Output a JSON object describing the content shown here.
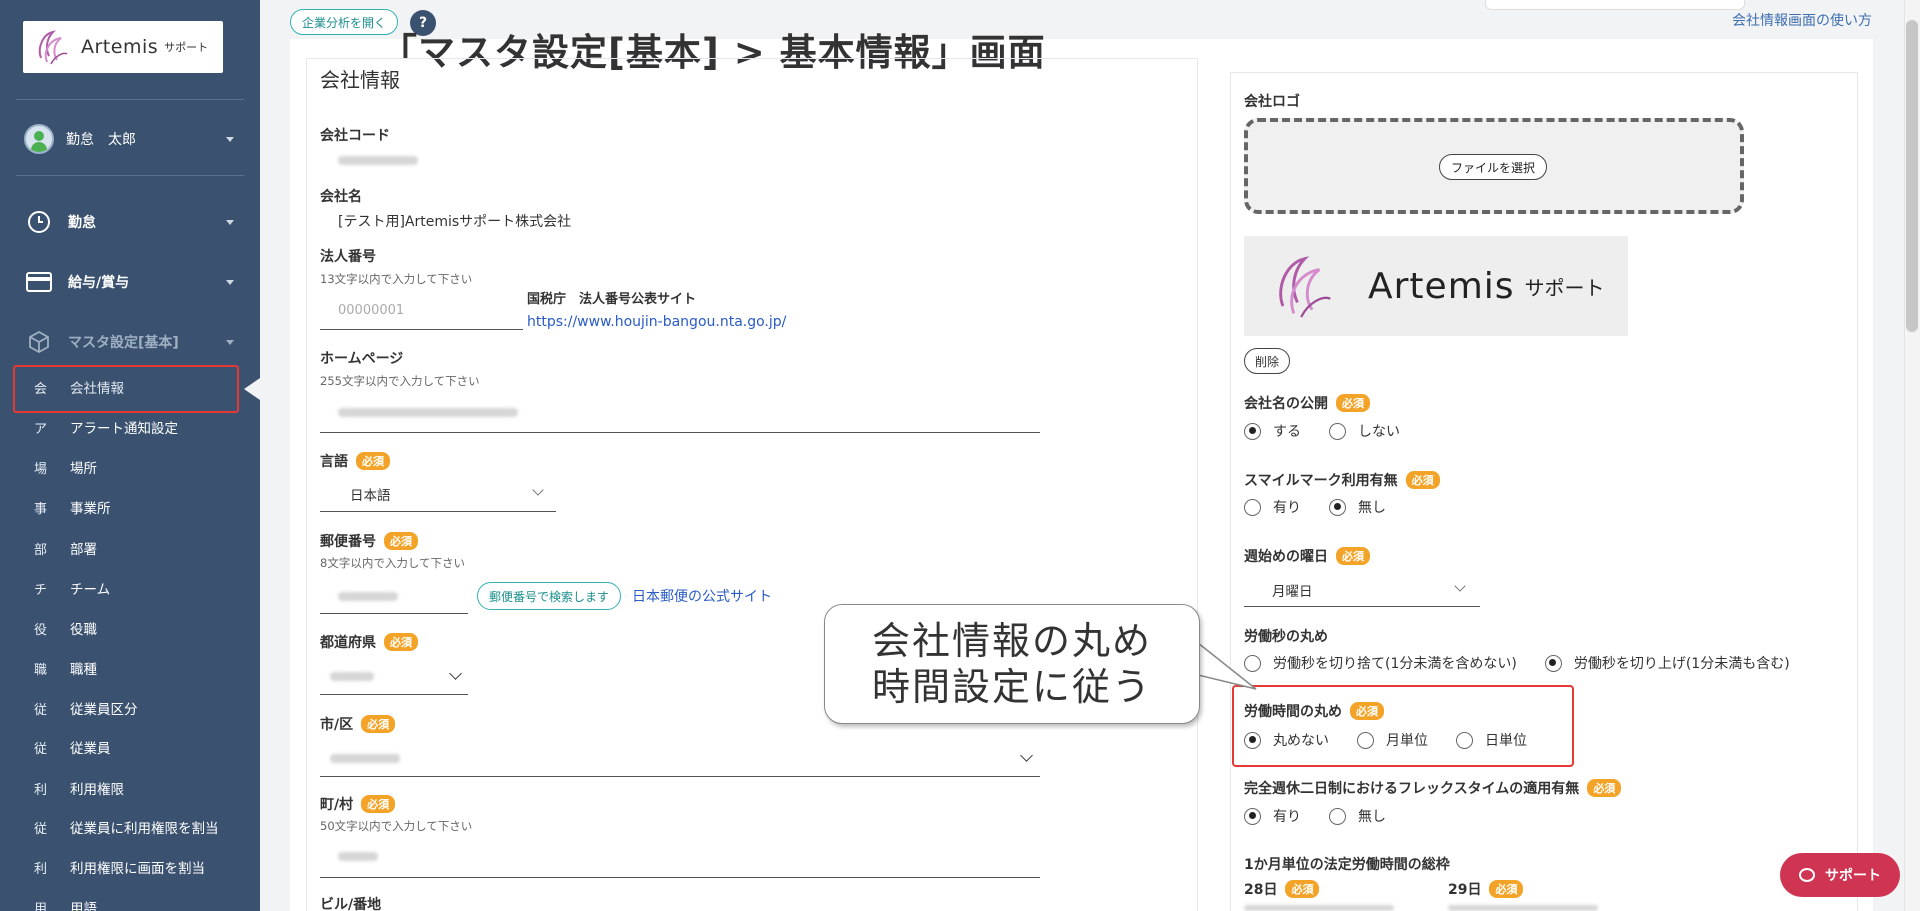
{
  "sidebar": {
    "logo": {
      "name": "Artemis",
      "sub": "サポート"
    },
    "user": {
      "name": "勤怠　太郎"
    },
    "nav": [
      {
        "label": "勤怠",
        "icon": "clock-icon"
      },
      {
        "label": "給与/賞与",
        "icon": "credit-card-icon"
      },
      {
        "label": "マスタ設定[基本]",
        "icon": "cube-icon"
      }
    ],
    "items": [
      {
        "ch": "会",
        "label": "会社情報"
      },
      {
        "ch": "ア",
        "label": "アラート通知設定"
      },
      {
        "ch": "場",
        "label": "場所"
      },
      {
        "ch": "事",
        "label": "事業所"
      },
      {
        "ch": "部",
        "label": "部署"
      },
      {
        "ch": "チ",
        "label": "チーム"
      },
      {
        "ch": "役",
        "label": "役職"
      },
      {
        "ch": "職",
        "label": "職種"
      },
      {
        "ch": "従",
        "label": "従業員区分"
      },
      {
        "ch": "従",
        "label": "従業員"
      },
      {
        "ch": "利",
        "label": "利用権限"
      },
      {
        "ch": "従",
        "label": "従業員に利用権限を割当"
      },
      {
        "ch": "利",
        "label": "利用権限に画面を割当"
      },
      {
        "ch": "用",
        "label": "用語"
      }
    ]
  },
  "header": {
    "analysis_button": "企業分析を開く",
    "help_icon": "?",
    "page_heading": "「マスタ設定[基本] > 基本情報」画面",
    "help_link": "会社情報画面の使い方"
  },
  "left": {
    "section_title": "会社情報",
    "company_code": {
      "label": "会社コード"
    },
    "company_name": {
      "label": "会社名",
      "value": "[テスト用]Artemisサポート株式会社"
    },
    "corp_number": {
      "label": "法人番号",
      "hint": "13文字以内で入力して下さい",
      "placeholder": "00000001",
      "site_label": "国税庁　法人番号公表サイト",
      "site_url": "https://www.houjin-bangou.nta.go.jp/"
    },
    "homepage": {
      "label": "ホームページ",
      "hint": "255文字以内で入力して下さい"
    },
    "language": {
      "label": "言語",
      "required": "必須",
      "value": "日本語"
    },
    "postal": {
      "label": "郵便番号",
      "required": "必須",
      "hint": "8文字以内で入力して下さい",
      "search_button": "郵便番号で検索します",
      "post_link": "日本郵便の公式サイト"
    },
    "prefecture": {
      "label": "都道府県",
      "required": "必須"
    },
    "city": {
      "label": "市/区",
      "required": "必須"
    },
    "town": {
      "label": "町/村",
      "required": "必須",
      "hint": "50文字以内で入力して下さい"
    },
    "building": {
      "label": "ビル/番地"
    }
  },
  "right": {
    "logo_label": "会社ロゴ",
    "file_button": "ファイルを選択",
    "preview": {
      "name": "Artemis",
      "sub": "サポート"
    },
    "delete_button": "削除",
    "publish_name": {
      "label": "会社名の公開",
      "required": "必須",
      "options": [
        "する",
        "しない"
      ]
    },
    "smile": {
      "label": "スマイルマーク利用有無",
      "required": "必須",
      "options": [
        "有り",
        "無し"
      ]
    },
    "week_start": {
      "label": "週始めの曜日",
      "required": "必須",
      "value": "月曜日"
    },
    "sec_rounding": {
      "label": "労働秒の丸め",
      "options": [
        "労働秒を切り捨て(1分未満を含めない)",
        "労働秒を切り上げ(1分未満も含む)"
      ]
    },
    "time_rounding": {
      "label": "労働時間の丸め",
      "required": "必須",
      "options": [
        "丸めない",
        "月単位",
        "日単位"
      ]
    },
    "flextime": {
      "label": "完全週休二日制におけるフレックスタイムの適用有無",
      "required": "必須",
      "options": [
        "有り",
        "無し"
      ]
    },
    "legal_hours": {
      "label": "1か月単位の法定労働時間の総枠",
      "days": [
        "28日",
        "29日"
      ],
      "required": "必須"
    }
  },
  "callout": {
    "line1": "会社情報の丸め",
    "line2": "時間設定に従う"
  },
  "support": {
    "label": "サポート"
  },
  "colors": {
    "sidebar": "#3a5270",
    "accent": "#35b1b1",
    "required": "#f3a428",
    "highlight": "#e53935",
    "support": "#d03453",
    "link": "#2a5bc7"
  }
}
